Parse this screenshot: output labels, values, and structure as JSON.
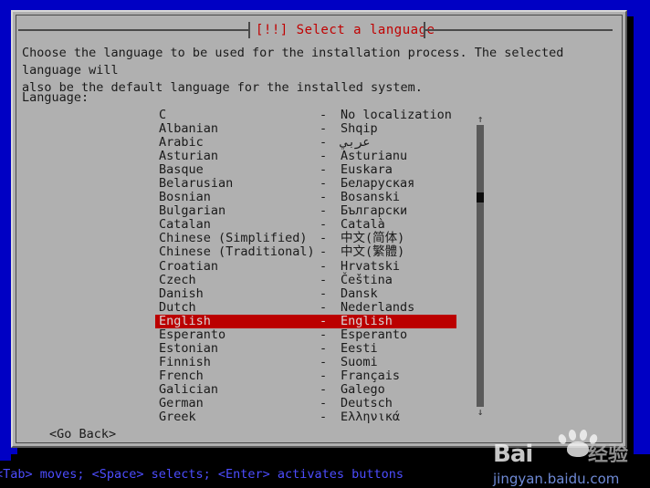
{
  "screen": {
    "background_color": "#0000c4",
    "dialog_background": "#b0b0b0",
    "accent_color": "#c00000",
    "selection_color": "#bb0000"
  },
  "dialog": {
    "title": "[!!] Select a language",
    "intro": "Choose the language to be used for the installation process. The selected language will\nalso be the default language for the installed system.",
    "language_label": "Language:",
    "go_back": "<Go Back>"
  },
  "list": {
    "dash": "-",
    "selected_index": 15,
    "items": [
      {
        "name": "C",
        "native": "No localization"
      },
      {
        "name": "Albanian",
        "native": "Shqip"
      },
      {
        "name": "Arabic",
        "native": "عربي"
      },
      {
        "name": "Asturian",
        "native": "Asturianu"
      },
      {
        "name": "Basque",
        "native": "Euskara"
      },
      {
        "name": "Belarusian",
        "native": "Беларуская"
      },
      {
        "name": "Bosnian",
        "native": "Bosanski"
      },
      {
        "name": "Bulgarian",
        "native": "Български"
      },
      {
        "name": "Catalan",
        "native": "Català"
      },
      {
        "name": "Chinese (Simplified)",
        "native": "中文(简体)"
      },
      {
        "name": "Chinese (Traditional)",
        "native": "中文(繁體)"
      },
      {
        "name": "Croatian",
        "native": "Hrvatski"
      },
      {
        "name": "Czech",
        "native": "Čeština"
      },
      {
        "name": "Danish",
        "native": "Dansk"
      },
      {
        "name": "Dutch",
        "native": "Nederlands"
      },
      {
        "name": "English",
        "native": "English"
      },
      {
        "name": "Esperanto",
        "native": "Esperanto"
      },
      {
        "name": "Estonian",
        "native": "Eesti"
      },
      {
        "name": "Finnish",
        "native": "Suomi"
      },
      {
        "name": "French",
        "native": "Français"
      },
      {
        "name": "Galician",
        "native": "Galego"
      },
      {
        "name": "German",
        "native": "Deutsch"
      },
      {
        "name": "Greek",
        "native": "Ελληνικά"
      }
    ]
  },
  "scrollbar": {
    "up_arrow": "↑",
    "down_arrow": "↓"
  },
  "status_bar": {
    "text": "<Tab> moves; <Space> selects; <Enter> activates buttons"
  },
  "watermark": {
    "logo": "Bai",
    "logo_cn": "经验",
    "logo_du": "du",
    "url": "jingyan.baidu.com"
  }
}
